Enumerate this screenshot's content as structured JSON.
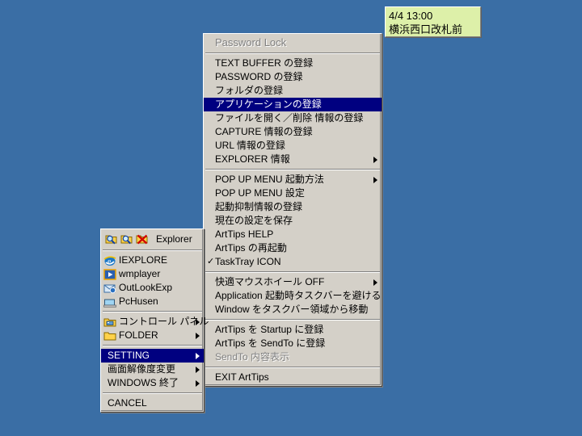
{
  "desktop": {
    "background_color": "#3a6ea5"
  },
  "tooltip": {
    "name": "artips-tooltip",
    "background_color": "#ddf0a9",
    "line1": "4/4 13:00",
    "line2": "横浜西口改札前"
  },
  "main_menu": {
    "highlight_color": "#000080",
    "background_color": "#d4d0c8",
    "header": {
      "label": "Password Lock",
      "disabled": true
    },
    "groups": [
      {
        "items": [
          {
            "label": "TEXT BUFFER の登録",
            "submenu": false,
            "checked": false,
            "disabled": false,
            "selected": false
          },
          {
            "label": "PASSWORD の登録",
            "submenu": false,
            "checked": false,
            "disabled": false,
            "selected": false
          },
          {
            "label": "フォルダの登録",
            "submenu": false,
            "checked": false,
            "disabled": false,
            "selected": false
          },
          {
            "label": "アプリケーションの登録",
            "submenu": false,
            "checked": false,
            "disabled": false,
            "selected": true
          },
          {
            "label": "ファイルを開く／削除 情報の登録",
            "submenu": false,
            "checked": false,
            "disabled": false,
            "selected": false
          },
          {
            "label": "CAPTURE 情報の登録",
            "submenu": false,
            "checked": false,
            "disabled": false,
            "selected": false
          },
          {
            "label": "URL 情報の登録",
            "submenu": false,
            "checked": false,
            "disabled": false,
            "selected": false
          },
          {
            "label": "EXPLORER 情報",
            "submenu": true,
            "checked": false,
            "disabled": false,
            "selected": false
          }
        ]
      },
      {
        "items": [
          {
            "label": "POP UP MENU 起動方法",
            "submenu": true,
            "checked": false,
            "disabled": false,
            "selected": false
          },
          {
            "label": "POP UP MENU 設定",
            "submenu": false,
            "checked": false,
            "disabled": false,
            "selected": false
          },
          {
            "label": "起動抑制情報の登録",
            "submenu": false,
            "checked": false,
            "disabled": false,
            "selected": false
          },
          {
            "label": "現在の設定を保存",
            "submenu": false,
            "checked": false,
            "disabled": false,
            "selected": false
          },
          {
            "label": "ArtTips HELP",
            "submenu": false,
            "checked": false,
            "disabled": false,
            "selected": false
          },
          {
            "label": "ArtTips の再起動",
            "submenu": false,
            "checked": false,
            "disabled": false,
            "selected": false
          },
          {
            "label": "TaskTray ICON",
            "submenu": false,
            "checked": true,
            "disabled": false,
            "selected": false
          }
        ]
      },
      {
        "items": [
          {
            "label": "快適マウスホイール OFF",
            "submenu": true,
            "checked": false,
            "disabled": false,
            "selected": false
          },
          {
            "label": "Application 起動時タスクバーを避ける",
            "submenu": false,
            "checked": false,
            "disabled": false,
            "selected": false
          },
          {
            "label": "Window をタスクバー領域から移動",
            "submenu": false,
            "checked": false,
            "disabled": false,
            "selected": false
          }
        ]
      },
      {
        "items": [
          {
            "label": "ArtTips を Startup に登録",
            "submenu": false,
            "checked": false,
            "disabled": false,
            "selected": false
          },
          {
            "label": "ArtTips を SendTo に登録",
            "submenu": false,
            "checked": false,
            "disabled": false,
            "selected": false
          },
          {
            "label": "SendTo 内容表示",
            "submenu": false,
            "checked": false,
            "disabled": true,
            "selected": false
          }
        ]
      },
      {
        "items": [
          {
            "label": "EXIT ArtTips",
            "submenu": false,
            "checked": false,
            "disabled": false,
            "selected": false
          }
        ]
      }
    ]
  },
  "left_menu": {
    "title_row": {
      "label": "Explorer",
      "icons": [
        "folder-search-icon",
        "folder-search-alt-icon",
        "folder-search-delete-icon"
      ]
    },
    "groups": [
      {
        "items": [
          {
            "label": "IEXPLORE",
            "icon": "internet-explorer-icon",
            "submenu": false,
            "selected": false
          },
          {
            "label": "wmplayer",
            "icon": "windows-media-player-icon",
            "submenu": false,
            "selected": false
          },
          {
            "label": "OutLookExp",
            "icon": "outlook-express-icon",
            "submenu": false,
            "selected": false
          },
          {
            "label": "PcHusen",
            "icon": "pchusen-icon",
            "submenu": false,
            "selected": false
          }
        ]
      },
      {
        "items": [
          {
            "label": "コントロール パネル",
            "icon": "control-panel-icon",
            "submenu": true,
            "selected": false
          },
          {
            "label": "FOLDER",
            "icon": "folder-icon",
            "submenu": true,
            "selected": false
          }
        ]
      },
      {
        "items": [
          {
            "label": "SETTING",
            "icon": "",
            "submenu": true,
            "selected": true
          },
          {
            "label": "画面解像度変更",
            "icon": "",
            "submenu": true,
            "selected": false
          },
          {
            "label": "WINDOWS 終了",
            "icon": "",
            "submenu": true,
            "selected": false
          }
        ]
      },
      {
        "items": [
          {
            "label": "CANCEL",
            "icon": "",
            "submenu": false,
            "selected": false
          }
        ]
      }
    ]
  }
}
